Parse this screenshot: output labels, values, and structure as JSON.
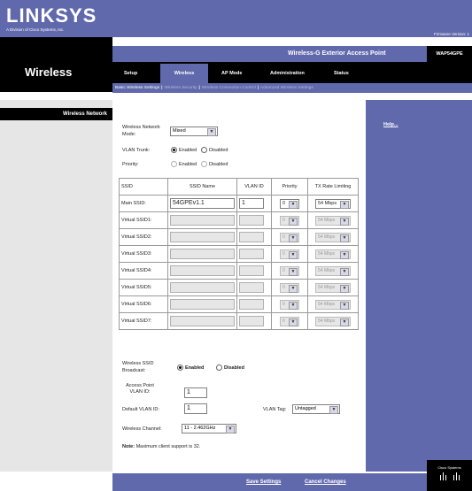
{
  "header": {
    "brand": "LINKSYS",
    "brand_sub": "A Division of Cisco Systems, Inc.",
    "firmware": "Firmware Version: 1",
    "product_name": "Wireless-G Exterior Access Point",
    "model": "WAP54GPE",
    "section": "Wireless"
  },
  "tabs": [
    {
      "label": "Setup"
    },
    {
      "label": "Wireless"
    },
    {
      "label": "AP Mode"
    },
    {
      "label": "Administration"
    },
    {
      "label": "Status"
    }
  ],
  "subnav": [
    {
      "label": "Basic Wireless Settings"
    },
    {
      "label": "Wireless Security"
    },
    {
      "label": "Wireless Connection Control"
    },
    {
      "label": "Advanced Wireless Settings"
    }
  ],
  "left_panel": {
    "title": "Wireless Network"
  },
  "help_link": "Help...",
  "form": {
    "network_mode_label": "Wireless Network Mode:",
    "network_mode_value": "Mixed",
    "vlan_trunk_label": "VLAN Trunk:",
    "vlan_trunk_enabled": "Enabled",
    "vlan_trunk_disabled": "Disabled",
    "priority_label": "Priority:",
    "priority_enabled": "Enabled",
    "priority_disabled": "Disabled",
    "ssid_broadcast_label": "Wireless SSID Broadcast:",
    "ssid_broadcast_enabled": "Enabled",
    "ssid_broadcast_disabled": "Disabled",
    "ap_vlan_label": "Access Point VLAN ID:",
    "ap_vlan_value": "1",
    "default_vlan_label": "Default VLAN ID:",
    "default_vlan_value": "1",
    "vlan_tag_label": "VLAN Tag:",
    "vlan_tag_value": "Untagged",
    "channel_label": "Wireless Channel:",
    "channel_value": "11 - 2.462GHz",
    "note_bold": "Note:",
    "note_text": "Maximum client support is 32."
  },
  "table": {
    "headers": [
      "SSID",
      "SSID Name",
      "VLAN ID",
      "Priority",
      "TX Rate Limiting"
    ],
    "rows": [
      {
        "label": "Main SSID:",
        "name": "54GPEv1.1",
        "vlan": "1",
        "priority": "0",
        "rate": "54 Mbps",
        "enabled": true
      },
      {
        "label": "Virtual SSID1:",
        "name": "",
        "vlan": "",
        "priority": "0",
        "rate": "54 Mbps",
        "enabled": false
      },
      {
        "label": "Virtual SSID2:",
        "name": "",
        "vlan": "",
        "priority": "0",
        "rate": "54 Mbps",
        "enabled": false
      },
      {
        "label": "Virtual SSID3:",
        "name": "",
        "vlan": "",
        "priority": "0",
        "rate": "54 Mbps",
        "enabled": false
      },
      {
        "label": "Virtual SSID4:",
        "name": "",
        "vlan": "",
        "priority": "0",
        "rate": "54 Mbps",
        "enabled": false
      },
      {
        "label": "Virtual SSID5:",
        "name": "",
        "vlan": "",
        "priority": "0",
        "rate": "54 Mbps",
        "enabled": false
      },
      {
        "label": "Virtual SSID6:",
        "name": "",
        "vlan": "",
        "priority": "0",
        "rate": "54 Mbps",
        "enabled": false
      },
      {
        "label": "Virtual SSID7:",
        "name": "",
        "vlan": "",
        "priority": "0",
        "rate": "54 Mbps",
        "enabled": false
      }
    ]
  },
  "buttons": {
    "save": "Save Settings",
    "cancel": "Cancel Changes"
  },
  "footer": {
    "logo": "Cisco Systems"
  },
  "colors": {
    "accent": "#6169ad",
    "dark": "#000000",
    "sidebar_gray": "#e6e6e6"
  },
  "icons": [
    "dropdown-arrow-icon",
    "cisco-bridge-icon"
  ]
}
